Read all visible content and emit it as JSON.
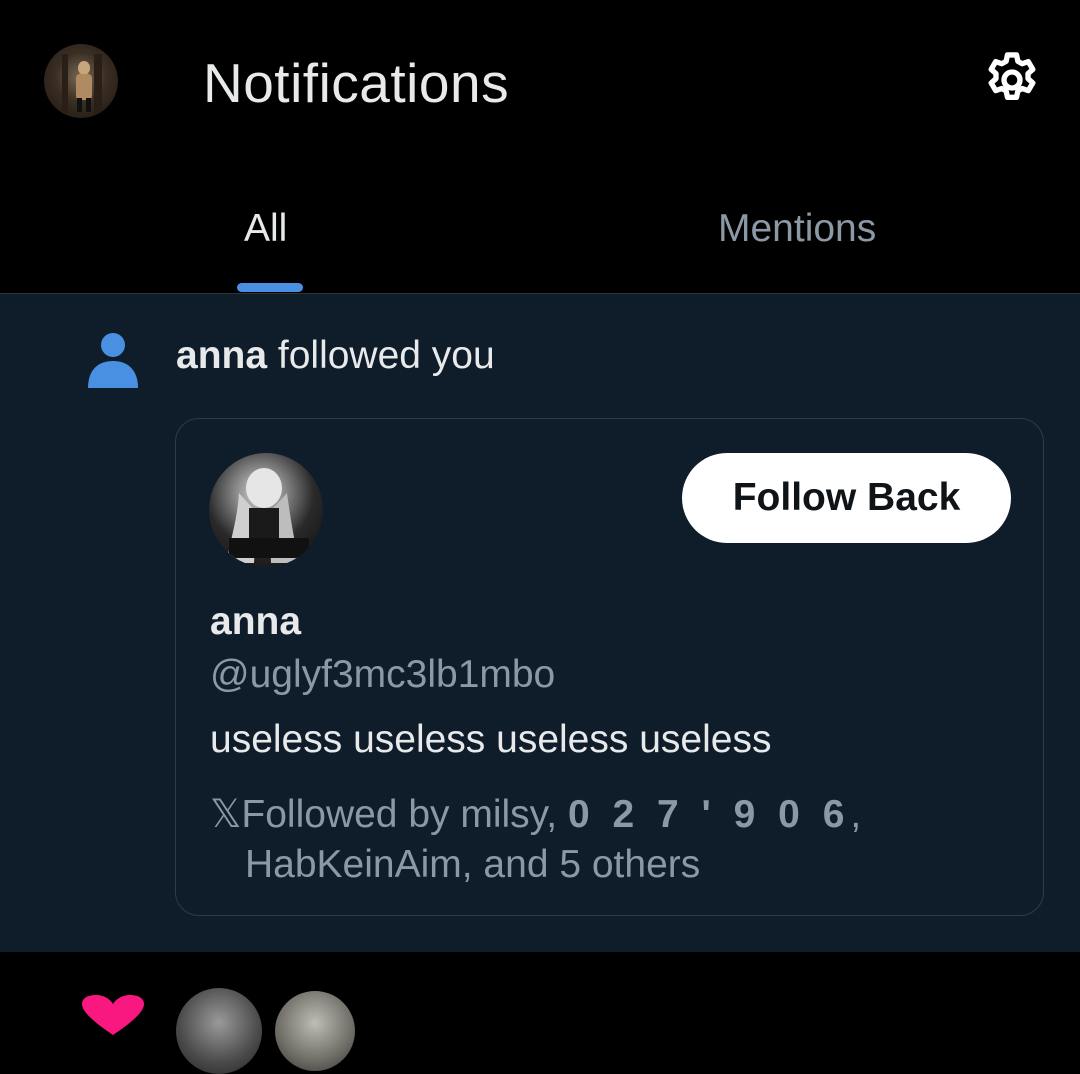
{
  "header": {
    "title": "Notifications",
    "avatar_icon": "user-avatar",
    "settings_icon": "gear-icon"
  },
  "tabs": [
    {
      "label": "All",
      "active": true
    },
    {
      "label": "Mentions",
      "active": false
    }
  ],
  "notification": {
    "icon": "person-icon",
    "actor": "anna",
    "action": "followed you",
    "card": {
      "name": "anna",
      "handle": "@uglyf3mc3lb1mbo",
      "bio": "useless useless useless useless",
      "follow_button": "Follow Back",
      "followed_by_prefix": "Followed by milsy,",
      "followed_by_bold": "0 2 7 ' 9 0 6",
      "followed_by_comma": ",",
      "followed_by_line2": "HabKeinAim, and 5 others",
      "x_glyph": "𝕏"
    }
  },
  "colors": {
    "background": "#000000",
    "notification_bg": "#0f1c29",
    "accent": "#4a90e2",
    "muted_text": "#8b98a5",
    "heart": "#f91880"
  }
}
